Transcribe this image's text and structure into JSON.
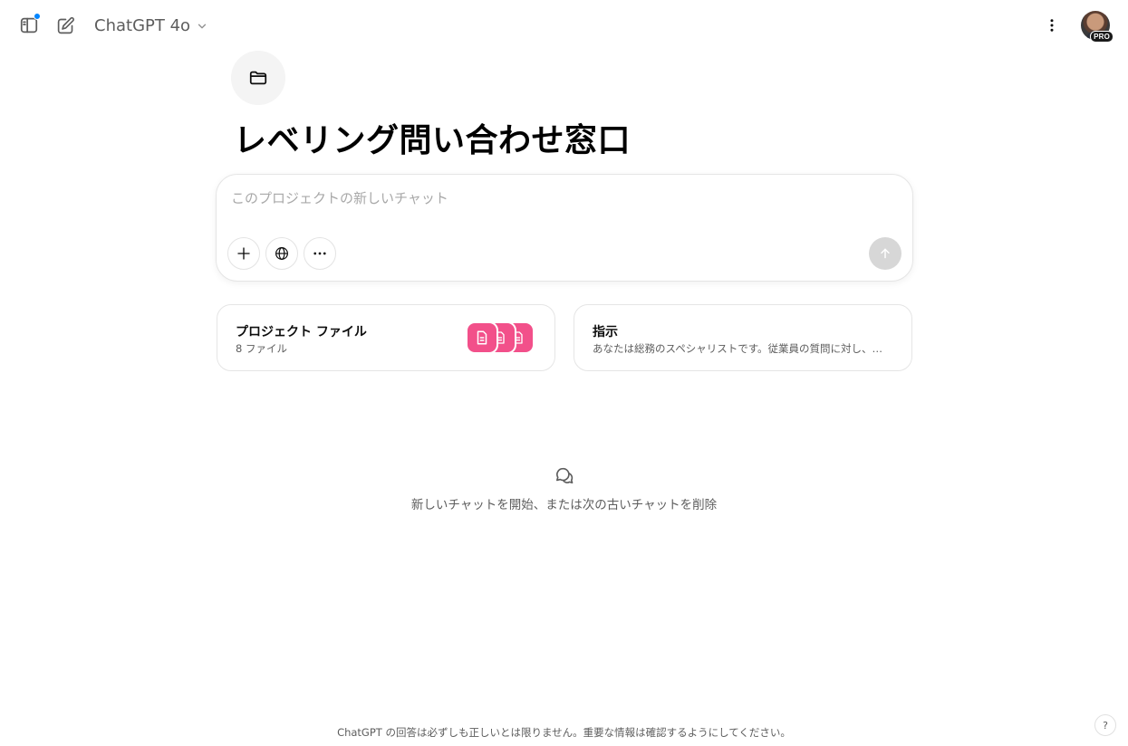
{
  "header": {
    "model_name": "ChatGPT 4o",
    "avatar_badge": "PRO",
    "notification_color": "#0285ff",
    "icons": [
      "sidebar-icon",
      "new-chat-icon",
      "chevron-down-icon",
      "more-vertical-icon"
    ]
  },
  "project": {
    "title": "レベリング問い合わせ窓口",
    "icon": "folder-icon"
  },
  "composer": {
    "placeholder": "このプロジェクトの新しいチャット",
    "value": "",
    "tools": [
      "plus-icon",
      "globe-icon",
      "more-horizontal-icon"
    ],
    "send_icon": "arrow-up-icon"
  },
  "cards": {
    "files": {
      "title": "プロジェクト ファイル",
      "subtitle": "8 ファイル",
      "tile_color": "#f2508a"
    },
    "instructions": {
      "title": "指示",
      "subtitle": "あなたは総務のスペシャリストです。従業員の質問に対し、適切な情..."
    }
  },
  "empty_state": {
    "icon": "chat-bubbles-icon",
    "text": "新しいチャットを開始、または次の古いチャットを削除"
  },
  "footer": {
    "disclaimer": "ChatGPT の回答は必ずしも正しいとは限りません。重要な情報は確認するようにしてください。",
    "help_label": "?"
  }
}
